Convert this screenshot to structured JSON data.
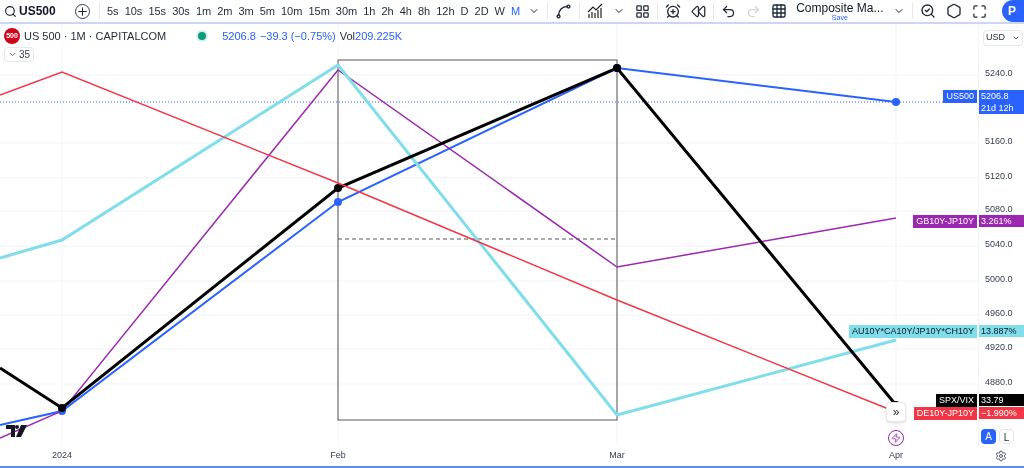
{
  "toolbar": {
    "symbol": "US500",
    "intervals": [
      {
        "label": "5s",
        "selected": false
      },
      {
        "label": "10s",
        "selected": false
      },
      {
        "label": "15s",
        "selected": false
      },
      {
        "label": "30s",
        "selected": false
      },
      {
        "label": "1m",
        "selected": false
      },
      {
        "label": "2m",
        "selected": false
      },
      {
        "label": "3m",
        "selected": false
      },
      {
        "label": "5m",
        "selected": false
      },
      {
        "label": "10m",
        "selected": false
      },
      {
        "label": "15m",
        "selected": false
      },
      {
        "label": "30m",
        "selected": false
      },
      {
        "label": "1h",
        "selected": false
      },
      {
        "label": "2h",
        "selected": false
      },
      {
        "label": "4h",
        "selected": false
      },
      {
        "label": "8h",
        "selected": false
      },
      {
        "label": "12h",
        "selected": false
      },
      {
        "label": "D",
        "selected": false
      },
      {
        "label": "2D",
        "selected": false
      },
      {
        "label": "W",
        "selected": false
      },
      {
        "label": "M",
        "selected": true
      }
    ],
    "redo_disabled": true,
    "layout_name": "Composite Ma...",
    "layout_save": "Save",
    "avatar": "P"
  },
  "legend": {
    "badge": "500",
    "title": "US 500 · 1M · CAPITALCOM",
    "price": "5206.8",
    "change": "−39.3 (−0.75%)",
    "vol_label": "Vol",
    "vol": "209.225K",
    "collapsed_count": "35"
  },
  "currency": "USD",
  "price_ticks": [
    "5240.0",
    "5160.0",
    "5120.0",
    "5080.0",
    "5040.0",
    "5000.0",
    "4960.0",
    "4920.0",
    "4880.0"
  ],
  "series": [
    {
      "name": "US500",
      "value": "5206.8",
      "countdown": "21d 12h",
      "color": "#2962ff"
    },
    {
      "name": "GB10Y-JP10Y",
      "value": "3.261%",
      "color": "#9c27b0"
    },
    {
      "name": "AU10Y*CA10Y/JP10Y*CH10Y",
      "value": "13.887%",
      "color": "#80deea"
    },
    {
      "name": "SPX/VIX",
      "value": "33.79",
      "color": "#000000"
    },
    {
      "name": "DE10Y-JP10Y",
      "value": "−1.990%",
      "color": "#f23645"
    }
  ],
  "scroll_button": "»",
  "time_ticks": [
    "2024",
    "Feb",
    "Mar",
    "Apr"
  ],
  "scale_buttons": [
    {
      "label": "A",
      "selected": true
    },
    {
      "label": "L",
      "selected": false
    }
  ]
}
